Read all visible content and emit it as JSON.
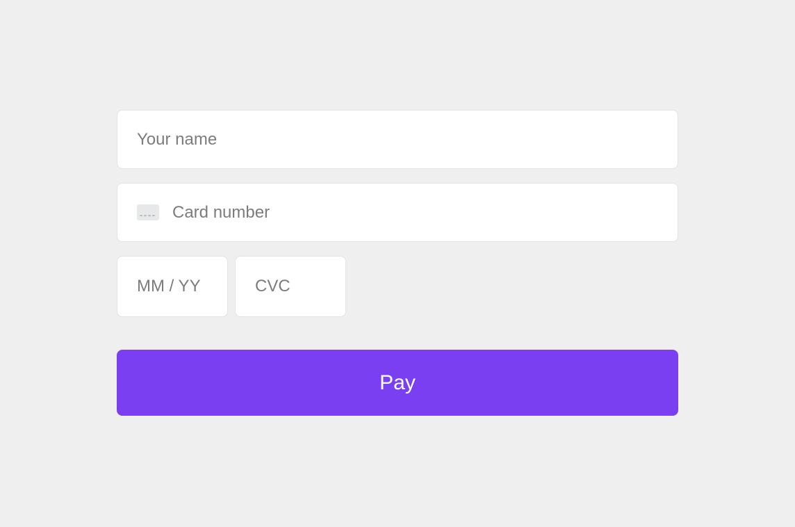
{
  "form": {
    "name_placeholder": "Your name",
    "name_value": "",
    "card_number_placeholder": "Card number",
    "card_number_value": "",
    "expiry_placeholder": "MM / YY",
    "expiry_value": "",
    "cvc_placeholder": "CVC",
    "cvc_value": ""
  },
  "button": {
    "pay_label": "Pay"
  },
  "colors": {
    "background": "#efefef",
    "input_bg": "#ffffff",
    "input_border": "#e3e3e3",
    "placeholder": "#7c7c7c",
    "button_bg": "#7b3ff2",
    "button_text": "#ffffff"
  }
}
